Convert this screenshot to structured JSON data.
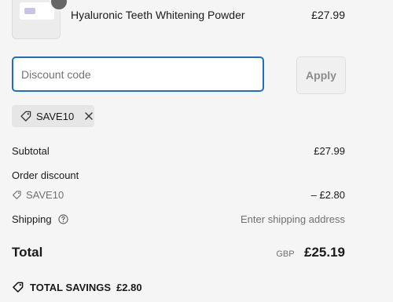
{
  "product": {
    "name": "Hyaluronic Teeth Whitening Powder",
    "price": "£27.99"
  },
  "discount": {
    "placeholder": "Discount code",
    "apply_label": "Apply",
    "applied_code": "SAVE10"
  },
  "summary": {
    "subtotal_label": "Subtotal",
    "subtotal_value": "£27.99",
    "order_discount_label": "Order discount",
    "order_discount_code": "SAVE10",
    "order_discount_value": "– £2.80",
    "shipping_label": "Shipping",
    "shipping_value": "Enter shipping address",
    "total_label": "Total",
    "currency": "GBP",
    "total_value": "£25.19"
  },
  "savings": {
    "label": "TOTAL SAVINGS",
    "value": "£2.80"
  },
  "icons": {
    "tag": "tag-icon",
    "close": "close-icon",
    "info": "question-circle-icon"
  },
  "colors": {
    "focus_border": "#1e6fbf",
    "background": "#f5f5f5",
    "muted_text": "#707070"
  }
}
